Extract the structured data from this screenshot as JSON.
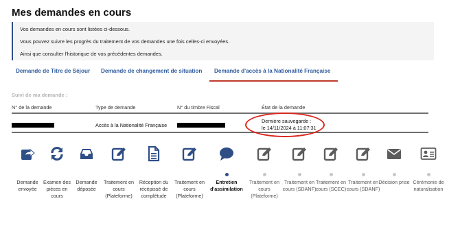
{
  "title": "Mes demandes en cours",
  "intro": {
    "line1": "Vos demandes en cours sont listées ci-dessous.",
    "line2": "Vous pouvez suivre les progrès du traitement de vos demandes une fois celles-ci envoyées.",
    "line3": "Ainsi que consulter l'historique de vos précédentes demandes."
  },
  "tabs": [
    {
      "label": "Demande de Titre de Séjour",
      "active": false
    },
    {
      "label": "Demande de changement de situation",
      "active": false
    },
    {
      "label": "Demande d'accès à la Nationalité Française",
      "active": true
    }
  ],
  "section_label": "Suivi de ma demande :",
  "table": {
    "headers": [
      "N° de la demande",
      "Type de demande",
      "N° du timbre Fiscal",
      "État de la demande"
    ],
    "row": {
      "type": "Accès à la Nationalité Française",
      "status_line1": "Dernière sauvegarde :",
      "status_line2": "le 14/11/2024 à 11:07:31"
    }
  },
  "colors": {
    "accent": "#2f4e86",
    "tab_text": "#2f5d9f",
    "highlight": "#c0392b",
    "annotation": "#d9271f",
    "pending": "#c8c8c8"
  },
  "steps": [
    {
      "label": "Demande envoyée",
      "icon": "share-icon",
      "state": "done"
    },
    {
      "label": "Examen des pièces en cours",
      "icon": "refresh-icon",
      "state": "done"
    },
    {
      "label": "Demande déposée",
      "icon": "inbox-icon",
      "state": "done"
    },
    {
      "label": "Traitement en cours (Plateforme)",
      "icon": "edit-icon",
      "state": "done"
    },
    {
      "label": "Réception du récépissé de complétude",
      "icon": "document-icon",
      "state": "done"
    },
    {
      "label": "Traitement en cours (Plateforme)",
      "icon": "edit-icon",
      "state": "done"
    },
    {
      "label": "Entretien d'assimilation",
      "icon": "speech-bubble-icon",
      "state": "current"
    },
    {
      "label": "Traitement en cours (Plateforme)",
      "icon": "edit-icon",
      "state": "pending"
    },
    {
      "label": "Traitement en cours (SDANF)",
      "icon": "edit-icon",
      "state": "pending"
    },
    {
      "label": "Traitement en cours (SCEC)",
      "icon": "edit-icon",
      "state": "pending"
    },
    {
      "label": "Traitement en cours (SDANF)",
      "icon": "edit-icon",
      "state": "pending"
    },
    {
      "label": "Décision prise",
      "icon": "envelope-icon",
      "state": "pending"
    },
    {
      "label": "Cérémonie de naturalisation",
      "icon": "id-card-icon",
      "state": "pending"
    }
  ]
}
